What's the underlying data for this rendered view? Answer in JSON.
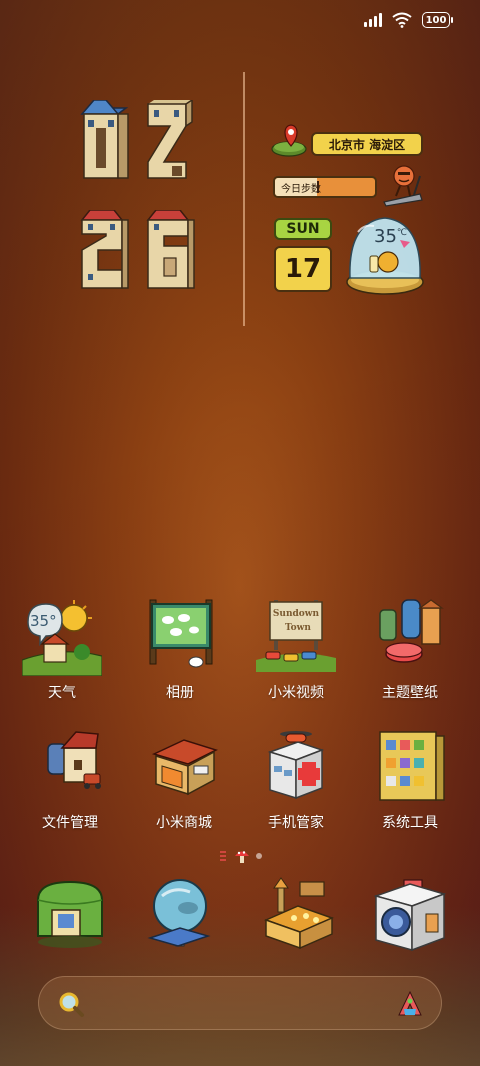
{
  "status_bar": {
    "battery": "100",
    "signal_icon": "signal-icon",
    "wifi_icon": "wifi-icon"
  },
  "clock_widget": {
    "hour": "02",
    "minute": "26"
  },
  "info_widget": {
    "location": "北京市 海淀区",
    "steps_label": "今日步数",
    "day": "SUN",
    "date": "17",
    "temperature": "35",
    "temperature_unit": "℃"
  },
  "apps": [
    {
      "label": "天气",
      "icon": "weather-icon",
      "weather_temp": "35°"
    },
    {
      "label": "相册",
      "icon": "gallery-icon"
    },
    {
      "label": "小米视频",
      "icon": "video-icon",
      "sign_text": [
        "Sundown",
        "Town"
      ]
    },
    {
      "label": "主题壁纸",
      "icon": "themes-icon"
    },
    {
      "label": "文件管理",
      "icon": "file-manager-icon"
    },
    {
      "label": "小米商城",
      "icon": "mi-store-icon"
    },
    {
      "label": "手机管家",
      "icon": "security-icon"
    },
    {
      "label": "系统工具",
      "icon": "tools-folder-icon"
    }
  ],
  "page_indicator": {
    "count": 2,
    "current": 1
  },
  "dock": [
    {
      "icon": "phone-icon"
    },
    {
      "icon": "messages-icon"
    },
    {
      "icon": "browser-icon"
    },
    {
      "icon": "camera-icon"
    }
  ],
  "search": {
    "icon": "search-icon",
    "assistant_icon": "assistant-icon"
  },
  "colors": {
    "accent_yellow": "#f2d24b",
    "accent_green": "#a8d442",
    "accent_orange": "#e8903a"
  }
}
